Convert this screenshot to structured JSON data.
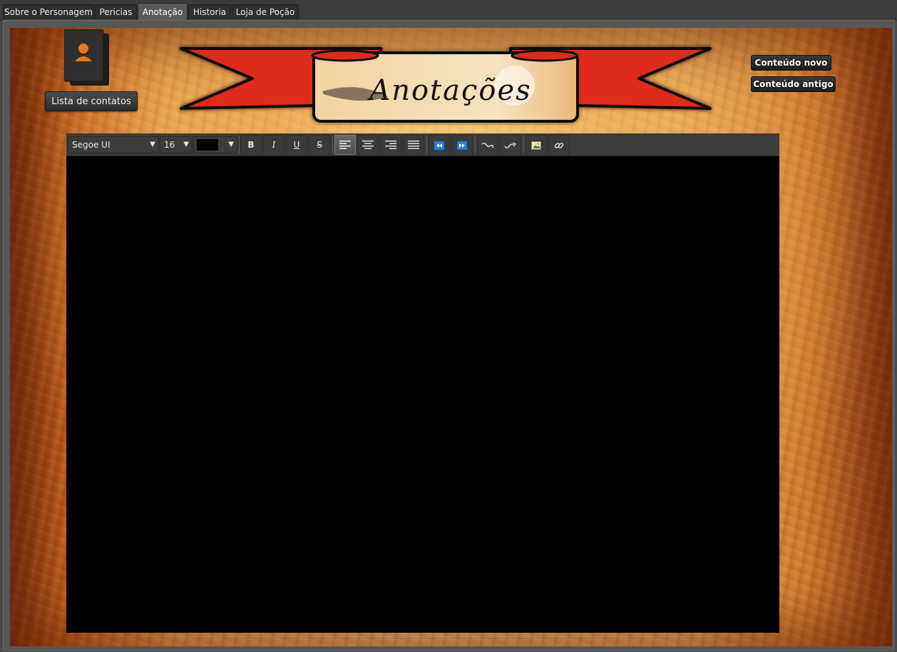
{
  "tabs": [
    {
      "label": "Sobre o Personagem"
    },
    {
      "label": "Pericias"
    },
    {
      "label": "Anotação"
    },
    {
      "label": "Historia"
    },
    {
      "label": "Loja de Poção"
    }
  ],
  "active_tab": "Anotação",
  "contacts_button": "Lista de contatos",
  "banner_title": "Anotações",
  "side_buttons": {
    "new_content": "Conteúdo novo",
    "old_content": "Conteúdo antigo"
  },
  "toolbar": {
    "font_family": "Segoe UI",
    "font_size": "16",
    "text_color": "#000000",
    "bold": "B",
    "italic": "I",
    "underline": "U",
    "strikethrough": "S",
    "alignment": "left"
  },
  "colors": {
    "accent_red": "#e02a1a",
    "contact_icon_orange": "#e87722"
  },
  "icons": [
    "contact-card-icon",
    "align-left-icon",
    "align-center-icon",
    "align-right-icon",
    "align-justify-icon",
    "decrease-indent-icon",
    "increase-indent-icon",
    "subscript-icon",
    "superscript-icon",
    "insert-image-icon",
    "insert-link-icon"
  ]
}
